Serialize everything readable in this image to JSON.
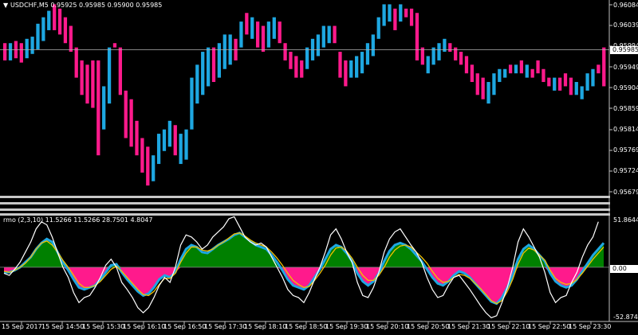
{
  "symbol_header": {
    "arrow": "▼",
    "text": "USDCHF,M5  0.95925 0.95985 0.95900 0.95985"
  },
  "price_axis": {
    "labels": [
      "0.96084",
      "0.96039",
      "0.95994",
      "0.95949",
      "0.95904",
      "0.95859",
      "0.95814",
      "0.95769",
      "0.95724",
      "0.95679"
    ],
    "current_price": "0.95985"
  },
  "indicator_header": {
    "text": "rmo (2,3,10)  11.5266 11.5266 28.7501 4.8047"
  },
  "indicator_axis": {
    "top": "51.8644",
    "zero": "0.00",
    "bottom": "-52.8743"
  },
  "time_axis": {
    "labels": [
      "15 Sep 2017",
      "15 Sep 14:50",
      "15 Sep 15:30",
      "15 Sep 16:10",
      "15 Sep 16:50",
      "15 Sep 17:30",
      "15 Sep 18:10",
      "15 Sep 18:50",
      "15 Sep 19:30",
      "15 Sep 20:10",
      "15 Sep 20:50",
      "15 Sep 21:30",
      "15 Sep 22:10",
      "15 Sep 22:50",
      "15 Sep 23:30"
    ]
  },
  "colors": {
    "background": "#000000",
    "bull": "#1ea7e1",
    "bear": "#ff1a8c",
    "histo_pos": "#008000",
    "histo_neg": "#ff1a8c",
    "rmo_line": "#ffffff",
    "signal_line": "#f2c200",
    "line_blue": "#1ea7e1",
    "grid": "#bfbfbf"
  },
  "chart_data": [
    {
      "type": "bar",
      "title": "USDCHF,M5",
      "ylim": [
        0.9565,
        0.961
      ],
      "bars": [
        [
          0.9596,
          0.96
        ],
        [
          0.9596,
          0.96
        ],
        [
          0.95965,
          0.96005
        ],
        [
          0.95955,
          0.96
        ],
        [
          0.95965,
          0.9601
        ],
        [
          0.95975,
          0.96015
        ],
        [
          0.95985,
          0.96045
        ],
        [
          0.96005,
          0.9606
        ],
        [
          0.9603,
          0.96075
        ],
        [
          0.9603,
          0.9609
        ],
        [
          0.9602,
          0.9608
        ],
        [
          0.96,
          0.9606
        ],
        [
          0.9598,
          0.9604
        ],
        [
          0.9592,
          0.9599
        ],
        [
          0.9588,
          0.9596
        ],
        [
          0.9586,
          0.9595
        ],
        [
          0.9585,
          0.9596
        ],
        [
          0.9574,
          0.9596
        ],
        [
          0.958,
          0.959
        ],
        [
          0.9586,
          0.9599
        ],
        [
          0.9599,
          0.96
        ],
        [
          0.9588,
          0.9599
        ],
        [
          0.9578,
          0.9589
        ],
        [
          0.9576,
          0.9587
        ],
        [
          0.9574,
          0.9582
        ],
        [
          0.957,
          0.9578
        ],
        [
          0.9567,
          0.9576
        ],
        [
          0.9568,
          0.9574
        ],
        [
          0.9572,
          0.9579
        ],
        [
          0.9575,
          0.958
        ],
        [
          0.9576,
          0.9582
        ],
        [
          0.9574,
          0.9581
        ],
        [
          0.9572,
          0.9579
        ],
        [
          0.9573,
          0.958
        ],
        [
          0.958,
          0.9592
        ],
        [
          0.9586,
          0.9595
        ],
        [
          0.9588,
          0.9598
        ],
        [
          0.959,
          0.9599
        ],
        [
          0.9591,
          0.9599
        ],
        [
          0.9592,
          0.96
        ],
        [
          0.9594,
          0.9602
        ],
        [
          0.9595,
          0.9602
        ],
        [
          0.9596,
          0.9601
        ],
        [
          0.9599,
          0.9605
        ],
        [
          0.9602,
          0.9607
        ],
        [
          0.9601,
          0.9606
        ],
        [
          0.9599,
          0.9605
        ],
        [
          0.9598,
          0.9604
        ],
        [
          0.9599,
          0.9605
        ],
        [
          0.9601,
          0.9606
        ],
        [
          0.96,
          0.9605
        ],
        [
          0.9596,
          0.96
        ],
        [
          0.9594,
          0.9598
        ],
        [
          0.9592,
          0.9597
        ],
        [
          0.9592,
          0.9596
        ],
        [
          0.9594,
          0.9599
        ],
        [
          0.9596,
          0.9601
        ],
        [
          0.9597,
          0.9602
        ],
        [
          0.9599,
          0.9604
        ],
        [
          0.96,
          0.9604
        ],
        [
          0.96,
          0.9604
        ],
        [
          0.9592,
          0.9598
        ],
        [
          0.959,
          0.9596
        ],
        [
          0.9592,
          0.9596
        ],
        [
          0.9592,
          0.9597
        ],
        [
          0.9593,
          0.9598
        ],
        [
          0.9595,
          0.96
        ],
        [
          0.9597,
          0.9602
        ],
        [
          0.9601,
          0.9606
        ],
        [
          0.9604,
          0.9609
        ],
        [
          0.9605,
          0.9609
        ],
        [
          0.9603,
          0.9608
        ],
        [
          0.9605,
          0.9609
        ],
        [
          0.9606,
          0.9608
        ],
        [
          0.9604,
          0.9608
        ],
        [
          0.9596,
          0.9607
        ],
        [
          0.9595,
          0.9599
        ],
        [
          0.9593,
          0.9597
        ],
        [
          0.9595,
          0.9599
        ],
        [
          0.9596,
          0.96
        ],
        [
          0.9598,
          0.9601
        ],
        [
          0.9598,
          0.96
        ],
        [
          0.9596,
          0.9599
        ],
        [
          0.9595,
          0.9598
        ],
        [
          0.9593,
          0.9597
        ],
        [
          0.9591,
          0.9595
        ],
        [
          0.9588,
          0.9593
        ],
        [
          0.9587,
          0.9592
        ],
        [
          0.9586,
          0.9591
        ],
        [
          0.9588,
          0.9593
        ],
        [
          0.9591,
          0.9594
        ],
        [
          0.9592,
          0.9594
        ],
        [
          0.9593,
          0.9595
        ],
        [
          0.9593,
          0.9595
        ],
        [
          0.9593,
          0.9596
        ],
        [
          0.9592,
          0.9595
        ],
        [
          0.9592,
          0.9594
        ],
        [
          0.9593,
          0.9596
        ],
        [
          0.9591,
          0.9594
        ],
        [
          0.959,
          0.9592
        ],
        [
          0.9589,
          0.9592
        ],
        [
          0.9589,
          0.9592
        ],
        [
          0.959,
          0.9593
        ],
        [
          0.9588,
          0.9592
        ],
        [
          0.9588,
          0.9591
        ],
        [
          0.9587,
          0.959
        ],
        [
          0.9589,
          0.9593
        ],
        [
          0.959,
          0.9594
        ],
        [
          0.9593,
          0.9595
        ],
        [
          0.959,
          0.9599
        ]
      ],
      "direction": [
        "down",
        "up",
        "down",
        "down",
        "up",
        "up",
        "up",
        "up",
        "up",
        "down",
        "down",
        "down",
        "down",
        "down",
        "down",
        "down",
        "down",
        "down",
        "up",
        "up",
        "down",
        "down",
        "down",
        "down",
        "down",
        "down",
        "down",
        "up",
        "up",
        "up",
        "up",
        "down",
        "up",
        "up",
        "up",
        "up",
        "up",
        "up",
        "down",
        "up",
        "up",
        "up",
        "down",
        "up",
        "down",
        "up",
        "down",
        "down",
        "up",
        "up",
        "down",
        "down",
        "down",
        "down",
        "down",
        "up",
        "up",
        "up",
        "up",
        "up",
        "down",
        "down",
        "down",
        "up",
        "up",
        "up",
        "up",
        "up",
        "up",
        "up",
        "up",
        "down",
        "up",
        "down",
        "down",
        "down",
        "down",
        "up",
        "up",
        "up",
        "up",
        "down",
        "down",
        "down",
        "down",
        "down",
        "down",
        "down",
        "up",
        "up",
        "up",
        "up",
        "down",
        "up",
        "down",
        "up",
        "down",
        "down",
        "down",
        "down",
        "up",
        "down",
        "down",
        "down",
        "up",
        "up",
        "up",
        "up"
      ]
    },
    {
      "type": "area",
      "title": "rmo (2,3,10)",
      "ylim": [
        -52.8743,
        51.8644
      ],
      "histogram": [
        -5,
        -5,
        -3,
        0,
        5,
        10,
        18,
        24,
        28,
        25,
        15,
        5,
        -3,
        -12,
        -20,
        -22,
        -20,
        -18,
        -12,
        -5,
        2,
        3,
        -5,
        -12,
        -18,
        -24,
        -28,
        -26,
        -20,
        -12,
        -8,
        -10,
        -5,
        8,
        18,
        22,
        20,
        15,
        14,
        18,
        22,
        25,
        28,
        32,
        34,
        30,
        26,
        22,
        20,
        18,
        12,
        5,
        -3,
        -12,
        -18,
        -20,
        -22,
        -18,
        -10,
        -2,
        8,
        18,
        22,
        20,
        14,
        6,
        -6,
        -14,
        -18,
        -14,
        -6,
        6,
        16,
        22,
        24,
        22,
        18,
        12,
        6,
        -2,
        -10,
        -16,
        -18,
        -14,
        -8,
        -4,
        -6,
        -10,
        -16,
        -22,
        -28,
        -34,
        -36,
        -30,
        -20,
        -8,
        8,
        18,
        22,
        18,
        12,
        6,
        -6,
        -14,
        -18,
        -20,
        -18,
        -12,
        -4,
        4,
        12,
        18,
        24
      ],
      "rmo_line": [
        -6,
        -8,
        -2,
        5,
        15,
        25,
        38,
        45,
        42,
        30,
        15,
        0,
        -10,
        -25,
        -35,
        -30,
        -28,
        -20,
        -10,
        2,
        8,
        0,
        -15,
        -22,
        -30,
        -40,
        -45,
        -40,
        -30,
        -18,
        -10,
        -15,
        0,
        22,
        32,
        30,
        25,
        18,
        22,
        30,
        35,
        40,
        48,
        50,
        40,
        30,
        25,
        22,
        24,
        20,
        10,
        0,
        -10,
        -22,
        -28,
        -30,
        -35,
        -25,
        -12,
        0,
        15,
        32,
        38,
        28,
        15,
        5,
        -15,
        -28,
        -30,
        -20,
        -5,
        15,
        28,
        35,
        38,
        30,
        22,
        15,
        5,
        -10,
        -22,
        -30,
        -28,
        -18,
        -10,
        -8,
        -15,
        -22,
        -30,
        -38,
        -45,
        -50,
        -48,
        -35,
        -20,
        0,
        25,
        38,
        30,
        20,
        10,
        -5,
        -25,
        -35,
        -30,
        -28,
        -15,
        -5,
        10,
        22,
        30,
        45
      ],
      "signal_line": [
        -4,
        -5,
        -3,
        0,
        4,
        10,
        18,
        24,
        26,
        22,
        15,
        7,
        0,
        -8,
        -16,
        -20,
        -20,
        -18,
        -14,
        -8,
        -2,
        1,
        -4,
        -10,
        -16,
        -22,
        -27,
        -28,
        -24,
        -17,
        -11,
        -11,
        -6,
        5,
        14,
        20,
        20,
        17,
        16,
        18,
        22,
        25,
        29,
        33,
        34,
        31,
        27,
        24,
        22,
        20,
        15,
        9,
        2,
        -6,
        -13,
        -17,
        -20,
        -19,
        -13,
        -6,
        2,
        12,
        19,
        20,
        16,
        9,
        0,
        -8,
        -13,
        -13,
        -8,
        0,
        10,
        17,
        21,
        22,
        20,
        15,
        10,
        4,
        -4,
        -11,
        -15,
        -14,
        -10,
        -7,
        -8,
        -11,
        -16,
        -21,
        -27,
        -33,
        -36,
        -33,
        -24,
        -12,
        3,
        14,
        19,
        17,
        12,
        7,
        -3,
        -11,
        -15,
        -17,
        -16,
        -12,
        -6,
        1,
        8,
        14,
        20
      ]
    }
  ]
}
